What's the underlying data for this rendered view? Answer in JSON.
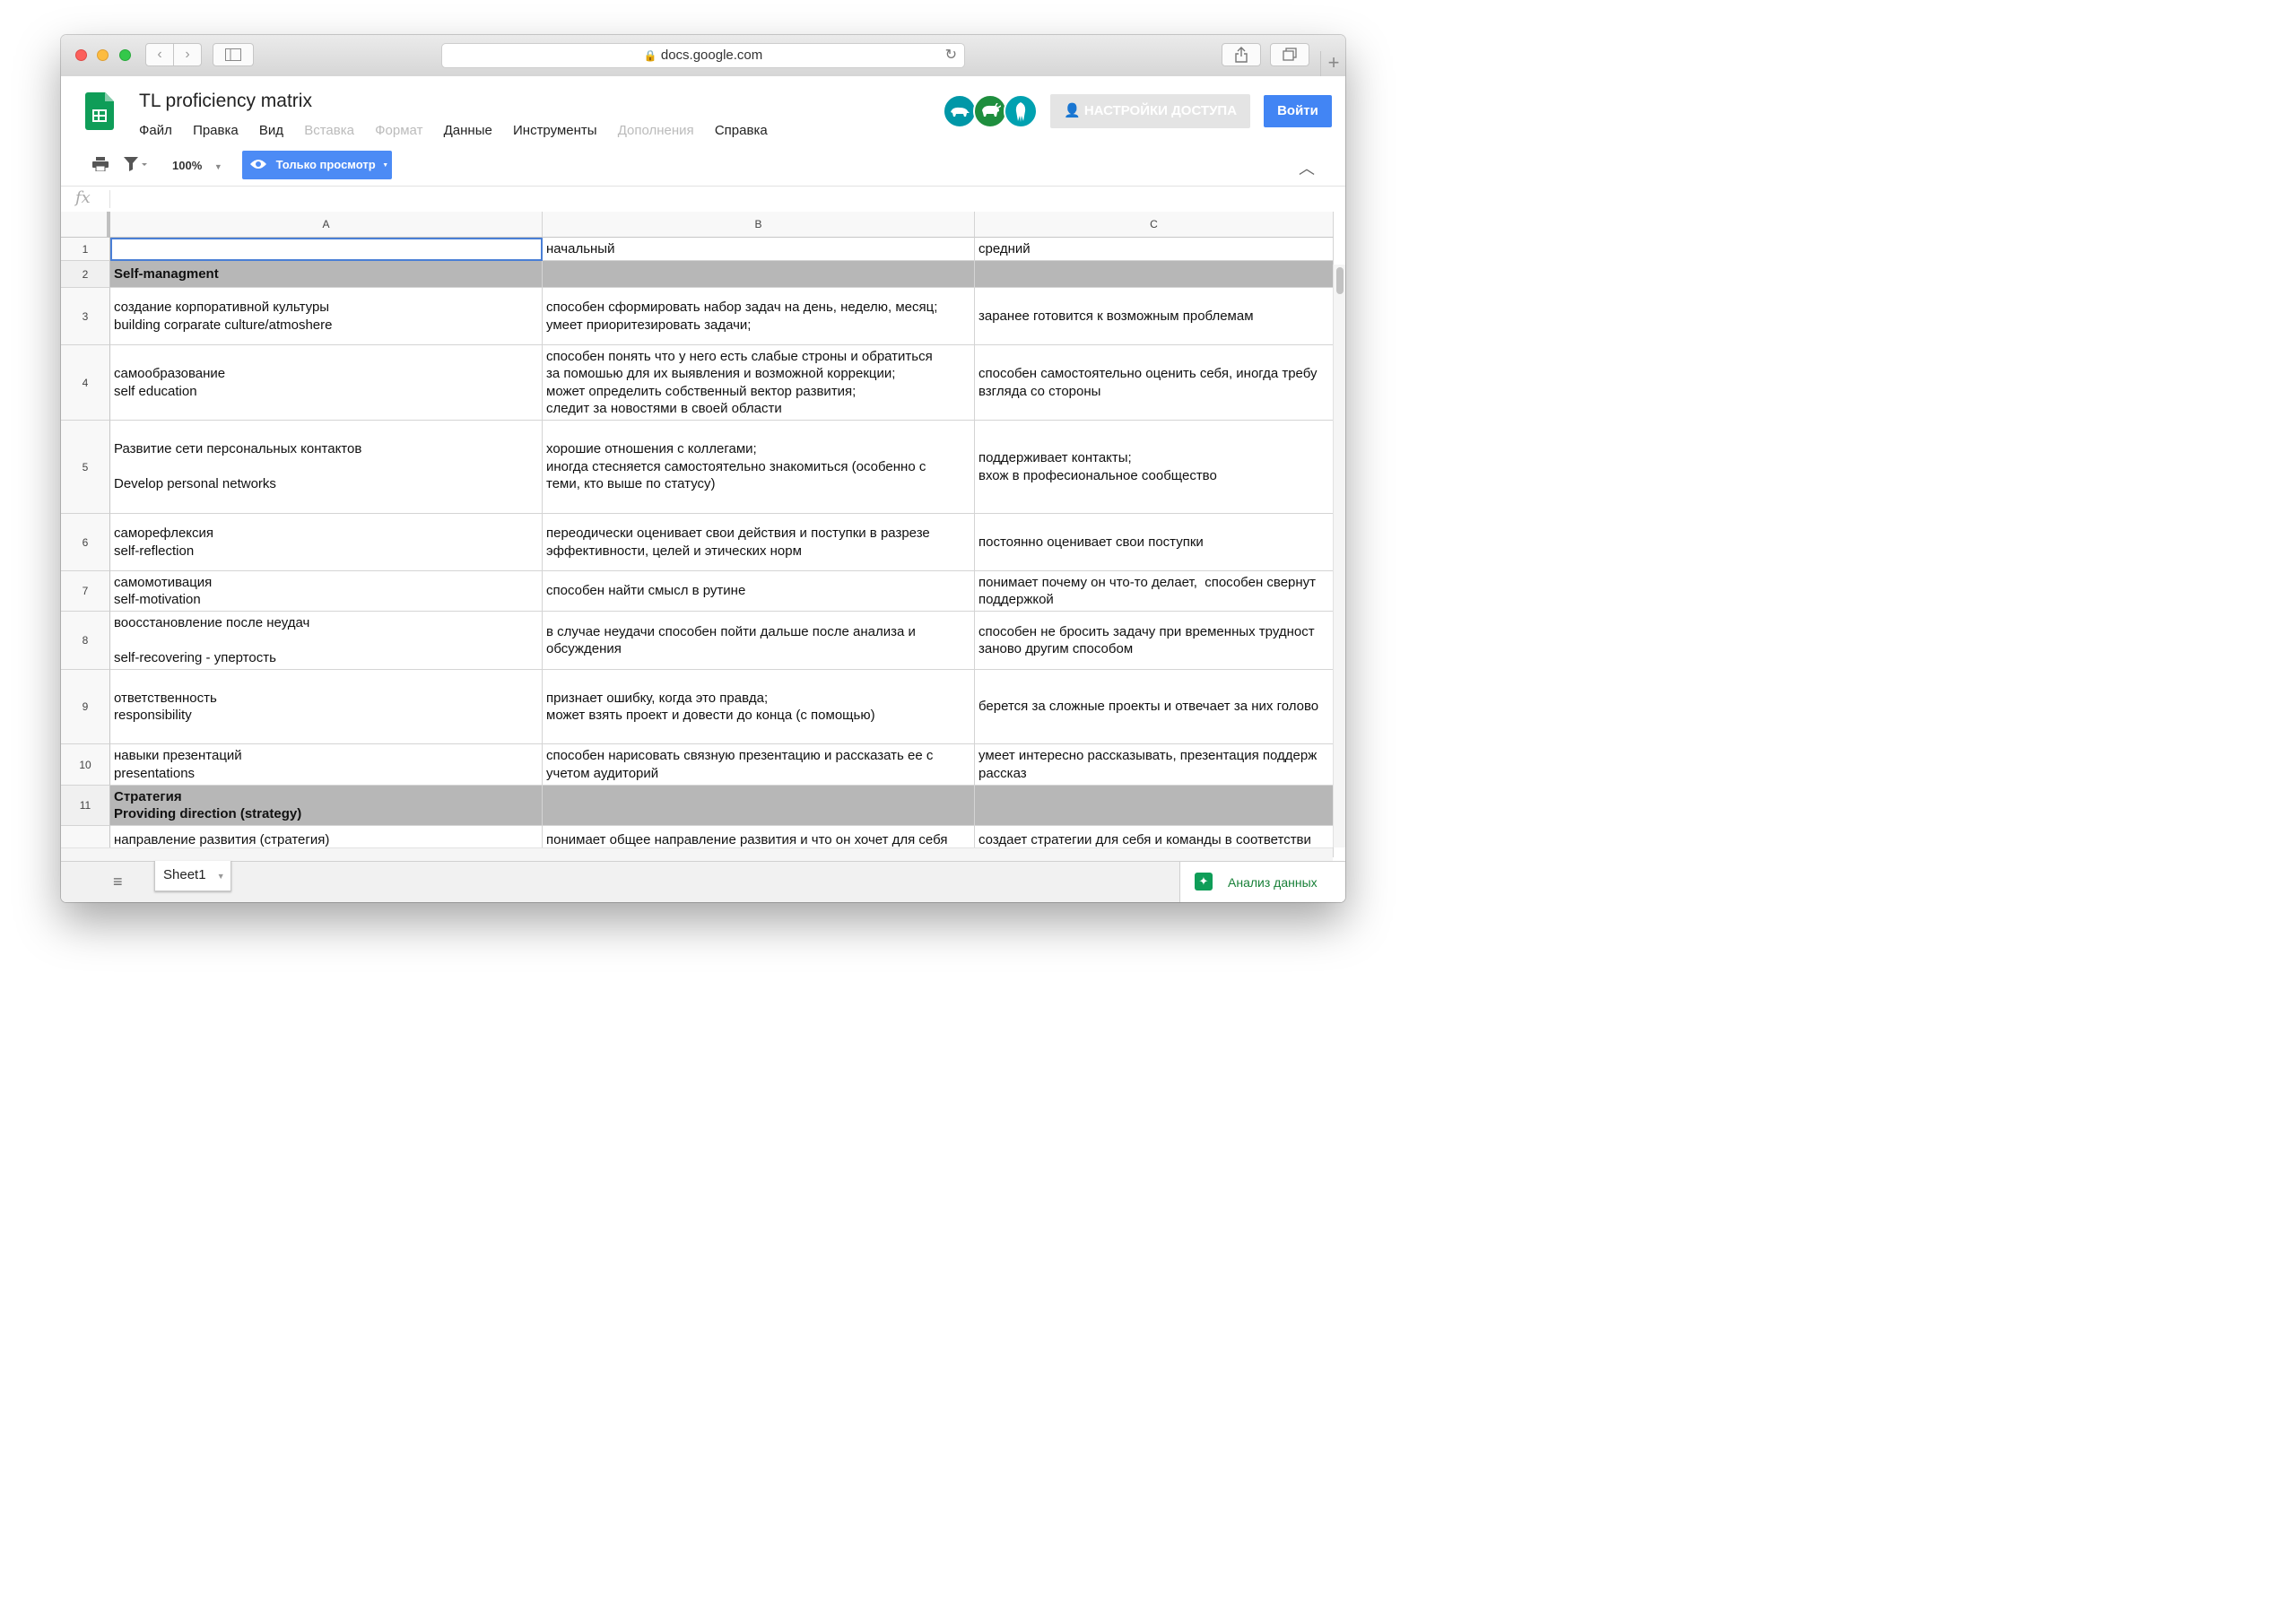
{
  "browser": {
    "url": "docs.google.com"
  },
  "doc": {
    "title": "TL proficiency matrix",
    "menu": [
      {
        "label": "Файл",
        "disabled": false
      },
      {
        "label": "Правка",
        "disabled": false
      },
      {
        "label": "Вид",
        "disabled": false
      },
      {
        "label": "Вставка",
        "disabled": true
      },
      {
        "label": "Формат",
        "disabled": true
      },
      {
        "label": "Данные",
        "disabled": false
      },
      {
        "label": "Инструменты",
        "disabled": false
      },
      {
        "label": "Дополнения",
        "disabled": true
      },
      {
        "label": "Справка",
        "disabled": false
      }
    ],
    "share_label": "НАСТРОЙКИ ДОСТУПА",
    "login_label": "Войти",
    "avatars": [
      {
        "icon": "tapir-icon",
        "color": "#0097a7"
      },
      {
        "icon": "buffalo-icon",
        "color": "#1e8e3e"
      },
      {
        "icon": "squid-icon",
        "color": "#00a1b0"
      }
    ]
  },
  "toolbar": {
    "zoom": "100%",
    "view_mode": "Только просмотр"
  },
  "formula_bar": {
    "fx": "fx",
    "value": ""
  },
  "sheet": {
    "columns": [
      "A",
      "B",
      "C"
    ],
    "rows": [
      {
        "num": "1",
        "section": false,
        "cells": [
          "",
          "начальный",
          "средний"
        ]
      },
      {
        "num": "2",
        "section": true,
        "cells": [
          "Self-managment",
          "",
          ""
        ]
      },
      {
        "num": "3",
        "section": false,
        "cells": [
          "создание корпоративной культуры\nbuilding corparate culture/atmoshere",
          "способен сформировать набор задач на день, неделю, месяц;\nумеет приоритезировать задачи;",
          "заранее готовится к возможным проблемам"
        ]
      },
      {
        "num": "4",
        "section": false,
        "cells": [
          "самообразование\nself education",
          "способен понять что у него есть слабые строны и обратиться\nза помошью для их выявления и возможной коррекции;\nможет определить собственный вектор развития;\nследит за новостями в своей области",
          "способен самостоятельно оценить себя, иногда требу\nвзгляда со стороны"
        ]
      },
      {
        "num": "5",
        "section": false,
        "cells": [
          "Развитие сети персональных контактов\n\nDevelop personal networks",
          "хорошие отношения с коллегами;\nиногда стесняется самостоятельно знакомиться (особенно с\nтеми, кто выше по статусу)",
          "поддерживает контакты;\nвхож в професиональное сообщество"
        ]
      },
      {
        "num": "6",
        "section": false,
        "cells": [
          "саморефлексия\nself-reflection",
          "переодически оценивает свои действия и поступки в разрезе\nэффективности, целей и этических норм",
          "постоянно оценивает свои поступки"
        ]
      },
      {
        "num": "7",
        "section": false,
        "cells": [
          "самомотивация\nself-motivation",
          "способен найти смысл в рутине",
          "понимает почему он что-то делает,  способен свернут\nподдержкой"
        ]
      },
      {
        "num": "8",
        "section": false,
        "cells": [
          "воосстановление после неудач\n\nself-recovering - упертость",
          "в случае неудачи способен пойти дальше после анализа и\nобсуждения",
          "способен не бросить задачу при временных трудност\nзаново другим способом"
        ]
      },
      {
        "num": "9",
        "section": false,
        "cells": [
          "ответственность\nresponsibility",
          "признает ошибку, когда это правда;\nможет взять проект и довести до конца (с помощью)",
          "берется за сложные проекты и отвечает за них голово"
        ]
      },
      {
        "num": "10",
        "section": false,
        "cells": [
          "навыки презентаций\npresentations",
          "способен нарисовать связную презентацию и рассказать ее с\nучетом аудиторий",
          "умеет интересно рассказывать, презентация поддерж\nрассказ"
        ]
      },
      {
        "num": "11",
        "section": true,
        "cells": [
          "Стратегия\nProviding direction (strategy)",
          "",
          ""
        ]
      },
      {
        "num": "",
        "section": false,
        "cells": [
          "направление развития (стратегия)",
          "понимает общее направление развития и что он хочет для себя",
          "создает стратегии для себя и команды в соответстви"
        ]
      }
    ]
  },
  "bottom": {
    "sheet_tab": "Sheet1",
    "explore_label": "Анализ данных"
  }
}
